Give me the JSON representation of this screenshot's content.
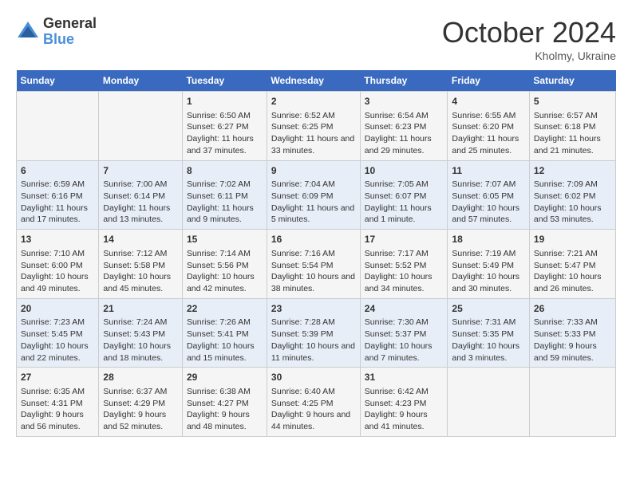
{
  "logo": {
    "general": "General",
    "blue": "Blue"
  },
  "title": "October 2024",
  "location": "Kholmy, Ukraine",
  "days_of_week": [
    "Sunday",
    "Monday",
    "Tuesday",
    "Wednesday",
    "Thursday",
    "Friday",
    "Saturday"
  ],
  "weeks": [
    [
      {
        "day": "",
        "data": ""
      },
      {
        "day": "",
        "data": ""
      },
      {
        "day": "1",
        "data": "Sunrise: 6:50 AM\nSunset: 6:27 PM\nDaylight: 11 hours and 37 minutes."
      },
      {
        "day": "2",
        "data": "Sunrise: 6:52 AM\nSunset: 6:25 PM\nDaylight: 11 hours and 33 minutes."
      },
      {
        "day": "3",
        "data": "Sunrise: 6:54 AM\nSunset: 6:23 PM\nDaylight: 11 hours and 29 minutes."
      },
      {
        "day": "4",
        "data": "Sunrise: 6:55 AM\nSunset: 6:20 PM\nDaylight: 11 hours and 25 minutes."
      },
      {
        "day": "5",
        "data": "Sunrise: 6:57 AM\nSunset: 6:18 PM\nDaylight: 11 hours and 21 minutes."
      }
    ],
    [
      {
        "day": "6",
        "data": "Sunrise: 6:59 AM\nSunset: 6:16 PM\nDaylight: 11 hours and 17 minutes."
      },
      {
        "day": "7",
        "data": "Sunrise: 7:00 AM\nSunset: 6:14 PM\nDaylight: 11 hours and 13 minutes."
      },
      {
        "day": "8",
        "data": "Sunrise: 7:02 AM\nSunset: 6:11 PM\nDaylight: 11 hours and 9 minutes."
      },
      {
        "day": "9",
        "data": "Sunrise: 7:04 AM\nSunset: 6:09 PM\nDaylight: 11 hours and 5 minutes."
      },
      {
        "day": "10",
        "data": "Sunrise: 7:05 AM\nSunset: 6:07 PM\nDaylight: 11 hours and 1 minute."
      },
      {
        "day": "11",
        "data": "Sunrise: 7:07 AM\nSunset: 6:05 PM\nDaylight: 10 hours and 57 minutes."
      },
      {
        "day": "12",
        "data": "Sunrise: 7:09 AM\nSunset: 6:02 PM\nDaylight: 10 hours and 53 minutes."
      }
    ],
    [
      {
        "day": "13",
        "data": "Sunrise: 7:10 AM\nSunset: 6:00 PM\nDaylight: 10 hours and 49 minutes."
      },
      {
        "day": "14",
        "data": "Sunrise: 7:12 AM\nSunset: 5:58 PM\nDaylight: 10 hours and 45 minutes."
      },
      {
        "day": "15",
        "data": "Sunrise: 7:14 AM\nSunset: 5:56 PM\nDaylight: 10 hours and 42 minutes."
      },
      {
        "day": "16",
        "data": "Sunrise: 7:16 AM\nSunset: 5:54 PM\nDaylight: 10 hours and 38 minutes."
      },
      {
        "day": "17",
        "data": "Sunrise: 7:17 AM\nSunset: 5:52 PM\nDaylight: 10 hours and 34 minutes."
      },
      {
        "day": "18",
        "data": "Sunrise: 7:19 AM\nSunset: 5:49 PM\nDaylight: 10 hours and 30 minutes."
      },
      {
        "day": "19",
        "data": "Sunrise: 7:21 AM\nSunset: 5:47 PM\nDaylight: 10 hours and 26 minutes."
      }
    ],
    [
      {
        "day": "20",
        "data": "Sunrise: 7:23 AM\nSunset: 5:45 PM\nDaylight: 10 hours and 22 minutes."
      },
      {
        "day": "21",
        "data": "Sunrise: 7:24 AM\nSunset: 5:43 PM\nDaylight: 10 hours and 18 minutes."
      },
      {
        "day": "22",
        "data": "Sunrise: 7:26 AM\nSunset: 5:41 PM\nDaylight: 10 hours and 15 minutes."
      },
      {
        "day": "23",
        "data": "Sunrise: 7:28 AM\nSunset: 5:39 PM\nDaylight: 10 hours and 11 minutes."
      },
      {
        "day": "24",
        "data": "Sunrise: 7:30 AM\nSunset: 5:37 PM\nDaylight: 10 hours and 7 minutes."
      },
      {
        "day": "25",
        "data": "Sunrise: 7:31 AM\nSunset: 5:35 PM\nDaylight: 10 hours and 3 minutes."
      },
      {
        "day": "26",
        "data": "Sunrise: 7:33 AM\nSunset: 5:33 PM\nDaylight: 9 hours and 59 minutes."
      }
    ],
    [
      {
        "day": "27",
        "data": "Sunrise: 6:35 AM\nSunset: 4:31 PM\nDaylight: 9 hours and 56 minutes."
      },
      {
        "day": "28",
        "data": "Sunrise: 6:37 AM\nSunset: 4:29 PM\nDaylight: 9 hours and 52 minutes."
      },
      {
        "day": "29",
        "data": "Sunrise: 6:38 AM\nSunset: 4:27 PM\nDaylight: 9 hours and 48 minutes."
      },
      {
        "day": "30",
        "data": "Sunrise: 6:40 AM\nSunset: 4:25 PM\nDaylight: 9 hours and 44 minutes."
      },
      {
        "day": "31",
        "data": "Sunrise: 6:42 AM\nSunset: 4:23 PM\nDaylight: 9 hours and 41 minutes."
      },
      {
        "day": "",
        "data": ""
      },
      {
        "day": "",
        "data": ""
      }
    ]
  ]
}
